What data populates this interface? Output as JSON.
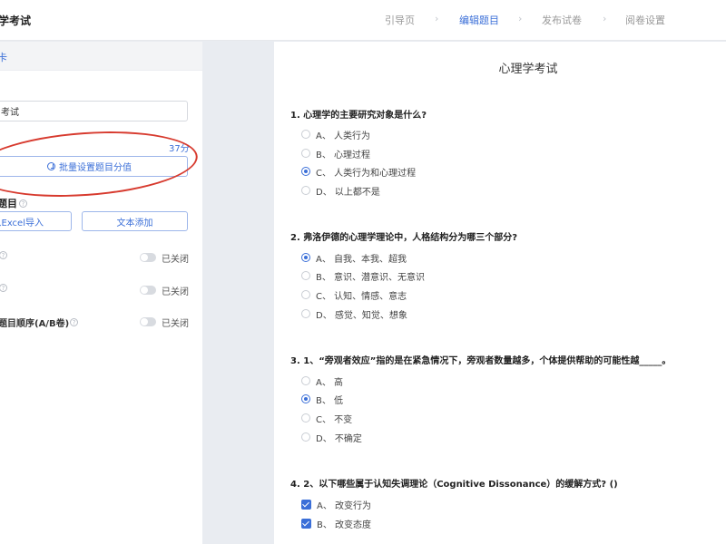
{
  "header": {
    "title": "学考试",
    "steps": [
      {
        "label": "引导页"
      },
      {
        "label": "编辑题目"
      },
      {
        "label": "发布试卷"
      },
      {
        "label": "阅卷设置"
      }
    ],
    "active_step": "编辑题目"
  },
  "left": {
    "head_label": "卡",
    "exam_name_value": "考试",
    "total_score": "37分",
    "batch_button": "批量设置题目分值",
    "add_section_title": "题目",
    "import_button": "从Excel导入",
    "text_button": "文本添加",
    "settings": [
      {
        "label": "",
        "state": "已关闭"
      },
      {
        "label": "",
        "state": "已关闭"
      },
      {
        "label": "题目顺序(A/B卷)",
        "state": "已关闭"
      }
    ],
    "accent_color": "#3b6fd8",
    "annotation_color": "#d73a2e"
  },
  "paper": {
    "title": "心理学考试",
    "questions": [
      {
        "title": "1. 心理学的主要研究对象是什么?",
        "options": [
          {
            "label": "A、 人类行为",
            "selected": false
          },
          {
            "label": "B、 心理过程",
            "selected": false
          },
          {
            "label": "C、 人类行为和心理过程",
            "selected": true
          },
          {
            "label": "D、 以上都不是",
            "selected": false
          }
        ]
      },
      {
        "title": "2. 弗洛伊德的心理学理论中，人格结构分为哪三个部分?",
        "options": [
          {
            "label": "A、 自我、本我、超我",
            "selected": true
          },
          {
            "label": "B、 意识、潜意识、无意识",
            "selected": false
          },
          {
            "label": "C、 认知、情感、意志",
            "selected": false
          },
          {
            "label": "D、 感觉、知觉、想象",
            "selected": false
          }
        ]
      },
      {
        "title": "3. 1、“旁观者效应”指的是在紧急情况下，旁观者数量越多，个体提供帮助的可能性越_____。",
        "options": [
          {
            "label": "A、 高",
            "selected": false
          },
          {
            "label": "B、 低",
            "selected": true
          },
          {
            "label": "C、 不变",
            "selected": false
          },
          {
            "label": "D、 不确定",
            "selected": false
          }
        ]
      },
      {
        "title": "4. 2、以下哪些属于认知失调理论（Cognitive Dissonance）的缓解方式? ()",
        "options": [
          {
            "label": "A、 改变行为",
            "checked": true
          },
          {
            "label": "B、 改变态度",
            "checked": true
          }
        ]
      }
    ]
  }
}
